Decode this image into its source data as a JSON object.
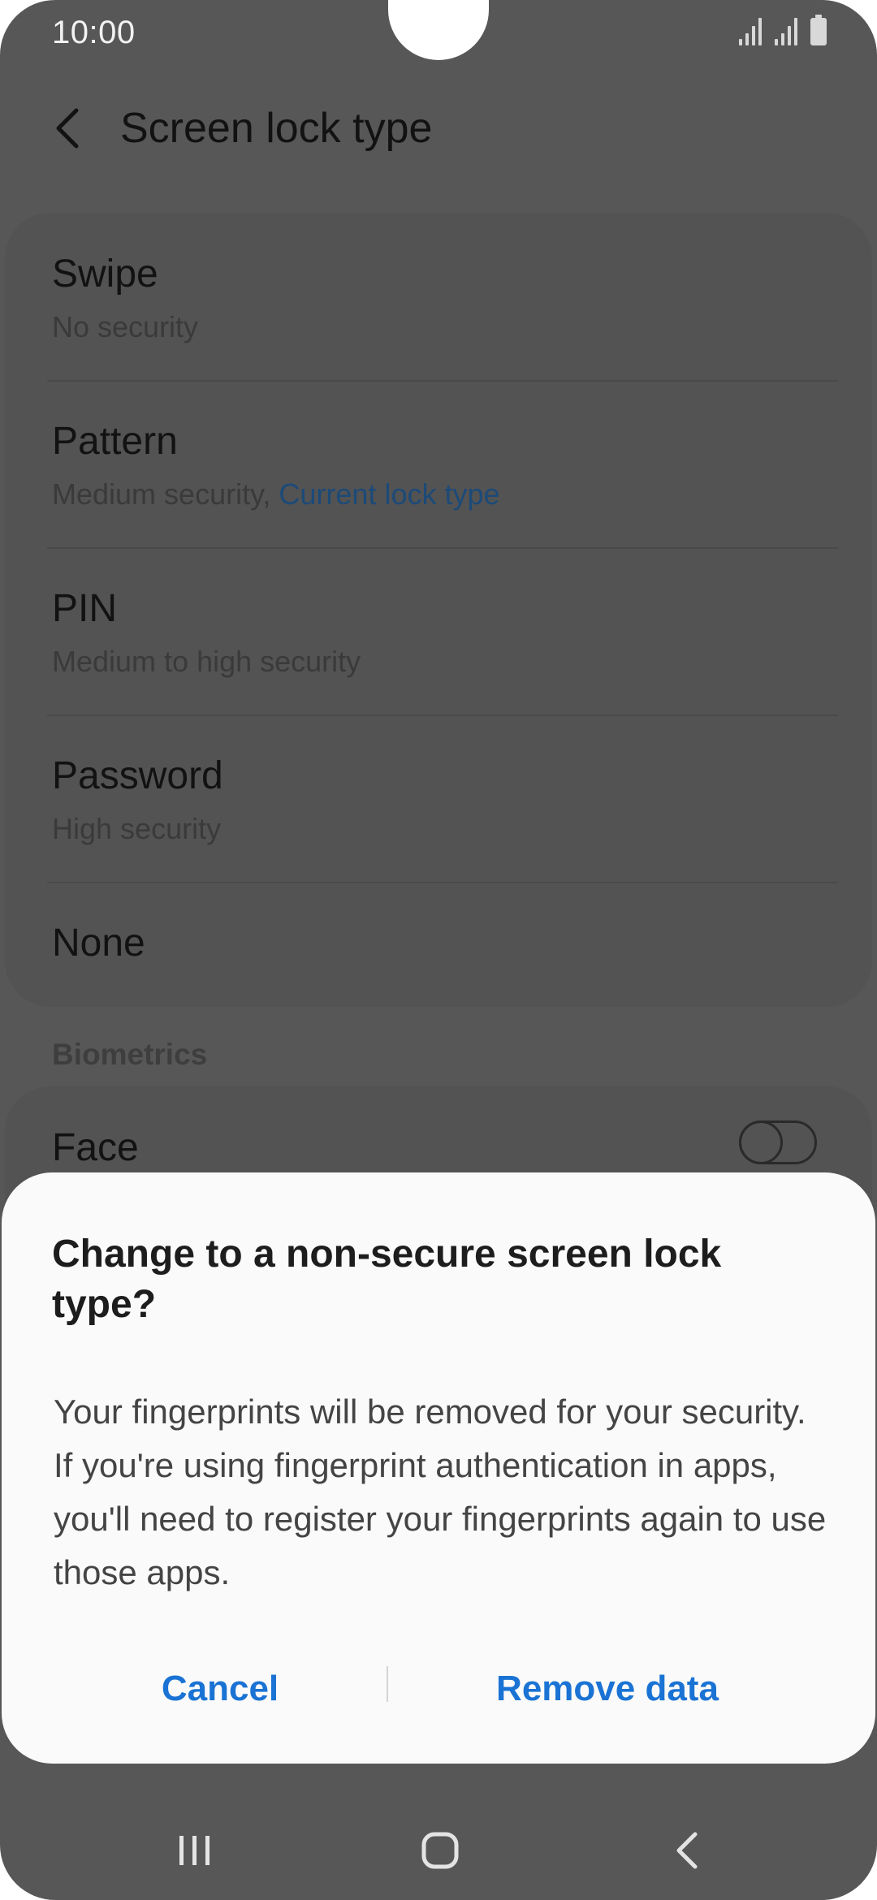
{
  "status_bar": {
    "time": "10:00",
    "icons": [
      "signal-icon",
      "signal-icon",
      "battery-icon"
    ]
  },
  "header": {
    "back_icon": "chevron-left-icon",
    "title": "Screen lock type"
  },
  "lock_options": [
    {
      "title": "Swipe",
      "subtitle": "No security"
    },
    {
      "title": "Pattern",
      "subtitle": "Medium security, ",
      "subtitle_accent": "Current lock type"
    },
    {
      "title": "PIN",
      "subtitle": "Medium to high security"
    },
    {
      "title": "Password",
      "subtitle": "High security"
    },
    {
      "title": "None"
    }
  ],
  "biometrics": {
    "section_label": "Biometrics",
    "face": {
      "title": "Face",
      "toggle_on": false
    }
  },
  "dialog": {
    "title": "Change to a non-secure screen lock type?",
    "body": "Your fingerprints will be removed for your security. If you're using fingerprint authentication in apps, you'll need to register your fingerprints again to use those apps.",
    "cancel_label": "Cancel",
    "confirm_label": "Remove data"
  },
  "nav_bar": {
    "icons": [
      "recent-apps-icon",
      "home-icon",
      "back-icon"
    ]
  },
  "colors": {
    "accent": "#1a73d4",
    "scrim_background": "#575757",
    "dialog_background": "#fafafa"
  }
}
